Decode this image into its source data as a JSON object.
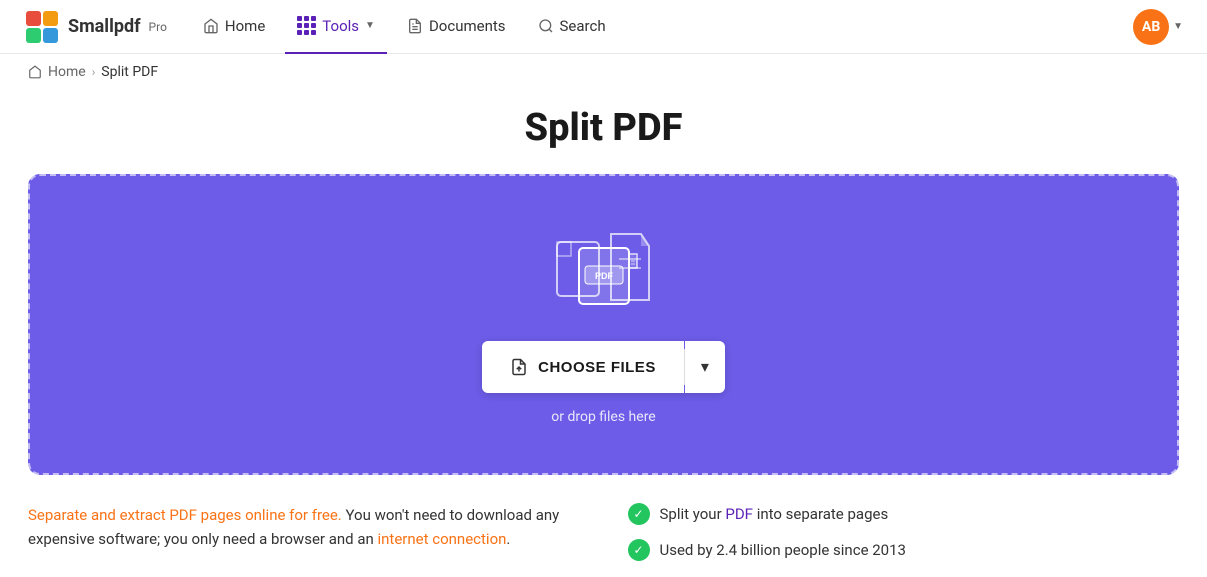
{
  "brand": {
    "logo_text": "Smallpdf",
    "logo_pro": "Pro"
  },
  "nav": {
    "home_label": "Home",
    "tools_label": "Tools",
    "documents_label": "Documents",
    "search_label": "Search",
    "avatar_initials": "AB"
  },
  "breadcrumb": {
    "home": "Home",
    "separator": "›",
    "current": "Split PDF"
  },
  "page": {
    "title": "Split PDF"
  },
  "dropzone": {
    "choose_files_label": "CHOOSE FILES",
    "drop_hint": "or drop files here"
  },
  "bottom": {
    "description": "Separate and extract PDF pages online for free. You won't need to download any expensive software; you only need a browser and an internet connection.",
    "feature1": "Split your PDF into separate pages",
    "feature2": "Used by 2.4 billion people since 2013"
  },
  "colors": {
    "purple": "#6c5ce7",
    "orange": "#f97316",
    "green": "#22c55e"
  }
}
